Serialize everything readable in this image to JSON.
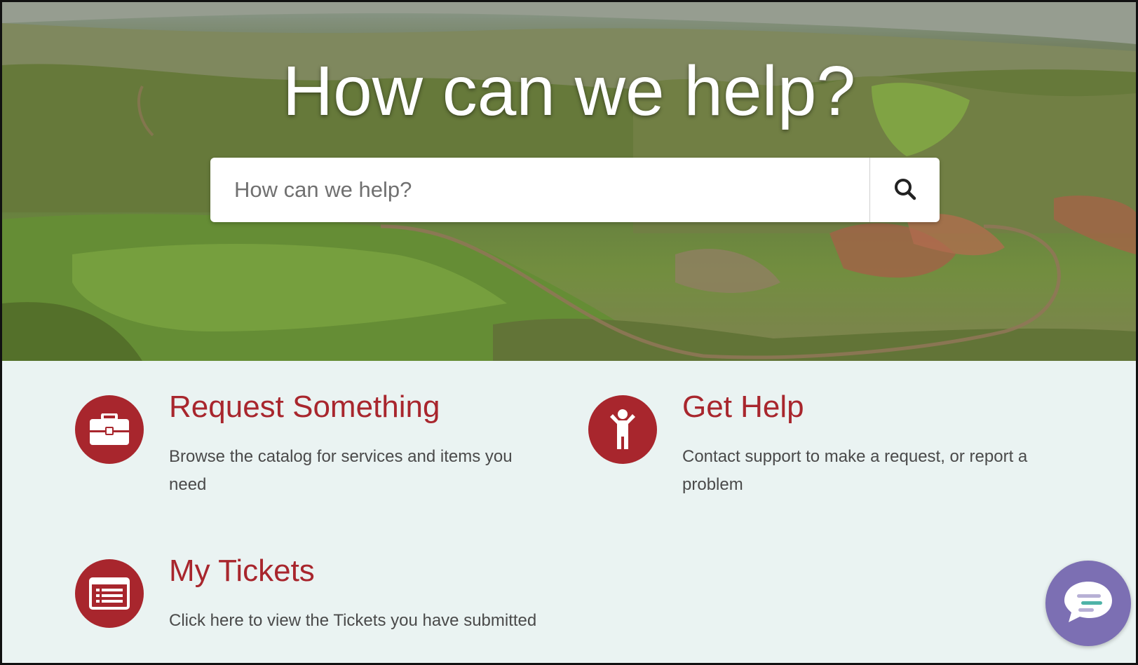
{
  "hero": {
    "title": "How can we help?"
  },
  "search": {
    "placeholder": "How can we help?"
  },
  "cards": [
    {
      "title": "Request Something",
      "description": "Browse the catalog for services and items you need",
      "icon": "briefcase-icon"
    },
    {
      "title": "Get Help",
      "description": "Contact support to make a request, or report a problem",
      "icon": "person-help-icon"
    },
    {
      "title": "My Tickets",
      "description": "Click here to view the Tickets you have submitted",
      "icon": "ticket-list-icon"
    }
  ],
  "chat": {
    "icon": "chat-bubble-icon"
  },
  "colors": {
    "accent": "#a8262d",
    "background": "#eaf3f2",
    "chat": "#7c6fb3",
    "text": "#4a4a4a"
  }
}
